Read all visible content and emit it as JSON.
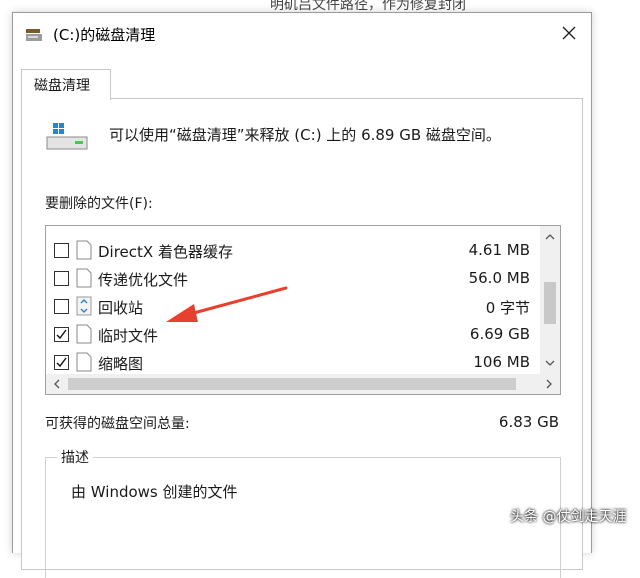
{
  "background_snippet": "明矶吕文件路径，作为修复封闭",
  "window": {
    "title": "(C:)的磁盘清理",
    "close_label": "✕"
  },
  "tab": {
    "label": "磁盘清理"
  },
  "header": {
    "description": "可以使用“磁盘清理”来释放 (C:) 上的 6.89 GB 磁盘空间。"
  },
  "files": {
    "label": "要删除的文件(F):",
    "items": [
      {
        "name": "DirectX 着色器缓存",
        "size": "4.61 MB",
        "checked": false,
        "icon": "file-icon"
      },
      {
        "name": "传递优化文件",
        "size": "56.0 MB",
        "checked": false,
        "icon": "file-icon"
      },
      {
        "name": "回收站",
        "size": "0 字节",
        "checked": false,
        "icon": "recycle-bin-icon"
      },
      {
        "name": "临时文件",
        "size": "6.69 GB",
        "checked": true,
        "icon": "file-icon"
      },
      {
        "name": "缩略图",
        "size": "106 MB",
        "checked": true,
        "icon": "file-icon"
      }
    ]
  },
  "total": {
    "label": "可获得的磁盘空间总量:",
    "value": "6.83 GB"
  },
  "description_group": {
    "title": "描述",
    "text": "由 Windows 创建的文件"
  },
  "watermark": "头条 @仗剑走天涯",
  "colors": {
    "arrow": "#e8402f",
    "drive_blue": "#1e88d6"
  }
}
